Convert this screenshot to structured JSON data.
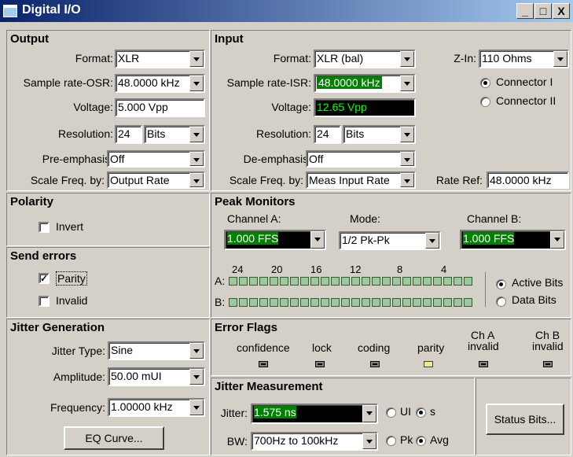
{
  "window": {
    "title": "Digital I/O",
    "min": "_",
    "max": "□",
    "close": "X"
  },
  "output": {
    "header": "Output",
    "format_label": "Format:",
    "format_value": "XLR",
    "sample_rate_label": "Sample rate-OSR:",
    "sample_rate_value": "48.0000 kHz",
    "voltage_label": "Voltage:",
    "voltage_value": "5.000   Vpp",
    "resolution_label": "Resolution:",
    "resolution_value": "24",
    "resolution_unit": "Bits",
    "preemphasis_label": "Pre-emphasis:",
    "preemphasis_value": "Off",
    "scale_label": "Scale Freq. by:",
    "scale_value": "Output Rate"
  },
  "input": {
    "header": "Input",
    "format_label": "Format:",
    "format_value": "XLR (bal)",
    "zin_label": "Z-In:",
    "zin_value": "110 Ohms",
    "connector1": "Connector I",
    "connector2": "Connector II",
    "sample_rate_label": "Sample rate-ISR:",
    "sample_rate_value": "48.0000 kHz",
    "voltage_label": "Voltage:",
    "voltage_value": "12.65   Vpp",
    "resolution_label": "Resolution:",
    "resolution_value": "24",
    "resolution_unit": "Bits",
    "deemphasis_label": "De-emphasis:",
    "deemphasis_value": "Off",
    "scale_label": "Scale Freq. by:",
    "scale_value": "Meas Input Rate",
    "rate_ref_label": "Rate Ref:",
    "rate_ref_value": "48.0000 kHz"
  },
  "polarity": {
    "header": "Polarity",
    "invert_label": "Invert"
  },
  "send_errors": {
    "header": "Send errors",
    "parity_label": "Parity",
    "invalid_label": "Invalid"
  },
  "peak": {
    "header": "Peak Monitors",
    "channel_a_label": "Channel A:",
    "channel_a_value": "1.000   FFS",
    "mode_label": "Mode:",
    "mode_value": "1/2 Pk-Pk",
    "channel_b_label": "Channel B:",
    "channel_b_value": "1.000   FFS",
    "bit_ticks": [
      "24",
      "20",
      "16",
      "12",
      "8",
      "4"
    ],
    "row_a": "A:",
    "row_b": "B:",
    "active_bits": "Active Bits",
    "data_bits": "Data Bits"
  },
  "jitter_gen": {
    "header": "Jitter Generation",
    "type_label": "Jitter Type:",
    "type_value": "Sine",
    "amplitude_label": "Amplitude:",
    "amplitude_value": "50.00   mUI",
    "frequency_label": "Frequency:",
    "frequency_value": "1.00000 kHz",
    "eq_button": "EQ Curve..."
  },
  "error_flags": {
    "header": "Error Flags",
    "confidence": "confidence",
    "lock": "lock",
    "coding": "coding",
    "parity": "parity",
    "cha_top": "Ch A",
    "cha_bottom": "invalid",
    "chb_top": "Ch B",
    "chb_bottom": "invalid"
  },
  "jitter_meas": {
    "header": "Jitter Measurement",
    "jitter_label": "Jitter:",
    "jitter_value": "1.575   ns",
    "ui_label": "UI",
    "s_label": "s",
    "bw_label": "BW:",
    "bw_value": "700Hz to 100kHz",
    "pk_label": "Pk",
    "avg_label": "Avg"
  },
  "status_button": "Status Bits..."
}
